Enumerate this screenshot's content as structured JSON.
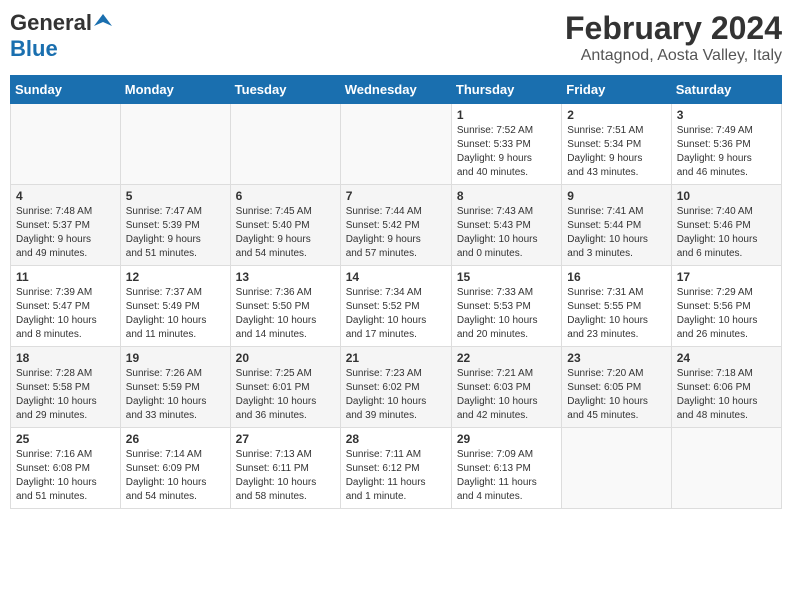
{
  "logo": {
    "general": "General",
    "blue": "Blue"
  },
  "title": "February 2024",
  "subtitle": "Antagnod, Aosta Valley, Italy",
  "columns": [
    "Sunday",
    "Monday",
    "Tuesday",
    "Wednesday",
    "Thursday",
    "Friday",
    "Saturday"
  ],
  "rows": [
    [
      {
        "day": "",
        "detail": ""
      },
      {
        "day": "",
        "detail": ""
      },
      {
        "day": "",
        "detail": ""
      },
      {
        "day": "",
        "detail": ""
      },
      {
        "day": "1",
        "detail": "Sunrise: 7:52 AM\nSunset: 5:33 PM\nDaylight: 9 hours\nand 40 minutes."
      },
      {
        "day": "2",
        "detail": "Sunrise: 7:51 AM\nSunset: 5:34 PM\nDaylight: 9 hours\nand 43 minutes."
      },
      {
        "day": "3",
        "detail": "Sunrise: 7:49 AM\nSunset: 5:36 PM\nDaylight: 9 hours\nand 46 minutes."
      }
    ],
    [
      {
        "day": "4",
        "detail": "Sunrise: 7:48 AM\nSunset: 5:37 PM\nDaylight: 9 hours\nand 49 minutes."
      },
      {
        "day": "5",
        "detail": "Sunrise: 7:47 AM\nSunset: 5:39 PM\nDaylight: 9 hours\nand 51 minutes."
      },
      {
        "day": "6",
        "detail": "Sunrise: 7:45 AM\nSunset: 5:40 PM\nDaylight: 9 hours\nand 54 minutes."
      },
      {
        "day": "7",
        "detail": "Sunrise: 7:44 AM\nSunset: 5:42 PM\nDaylight: 9 hours\nand 57 minutes."
      },
      {
        "day": "8",
        "detail": "Sunrise: 7:43 AM\nSunset: 5:43 PM\nDaylight: 10 hours\nand 0 minutes."
      },
      {
        "day": "9",
        "detail": "Sunrise: 7:41 AM\nSunset: 5:44 PM\nDaylight: 10 hours\nand 3 minutes."
      },
      {
        "day": "10",
        "detail": "Sunrise: 7:40 AM\nSunset: 5:46 PM\nDaylight: 10 hours\nand 6 minutes."
      }
    ],
    [
      {
        "day": "11",
        "detail": "Sunrise: 7:39 AM\nSunset: 5:47 PM\nDaylight: 10 hours\nand 8 minutes."
      },
      {
        "day": "12",
        "detail": "Sunrise: 7:37 AM\nSunset: 5:49 PM\nDaylight: 10 hours\nand 11 minutes."
      },
      {
        "day": "13",
        "detail": "Sunrise: 7:36 AM\nSunset: 5:50 PM\nDaylight: 10 hours\nand 14 minutes."
      },
      {
        "day": "14",
        "detail": "Sunrise: 7:34 AM\nSunset: 5:52 PM\nDaylight: 10 hours\nand 17 minutes."
      },
      {
        "day": "15",
        "detail": "Sunrise: 7:33 AM\nSunset: 5:53 PM\nDaylight: 10 hours\nand 20 minutes."
      },
      {
        "day": "16",
        "detail": "Sunrise: 7:31 AM\nSunset: 5:55 PM\nDaylight: 10 hours\nand 23 minutes."
      },
      {
        "day": "17",
        "detail": "Sunrise: 7:29 AM\nSunset: 5:56 PM\nDaylight: 10 hours\nand 26 minutes."
      }
    ],
    [
      {
        "day": "18",
        "detail": "Sunrise: 7:28 AM\nSunset: 5:58 PM\nDaylight: 10 hours\nand 29 minutes."
      },
      {
        "day": "19",
        "detail": "Sunrise: 7:26 AM\nSunset: 5:59 PM\nDaylight: 10 hours\nand 33 minutes."
      },
      {
        "day": "20",
        "detail": "Sunrise: 7:25 AM\nSunset: 6:01 PM\nDaylight: 10 hours\nand 36 minutes."
      },
      {
        "day": "21",
        "detail": "Sunrise: 7:23 AM\nSunset: 6:02 PM\nDaylight: 10 hours\nand 39 minutes."
      },
      {
        "day": "22",
        "detail": "Sunrise: 7:21 AM\nSunset: 6:03 PM\nDaylight: 10 hours\nand 42 minutes."
      },
      {
        "day": "23",
        "detail": "Sunrise: 7:20 AM\nSunset: 6:05 PM\nDaylight: 10 hours\nand 45 minutes."
      },
      {
        "day": "24",
        "detail": "Sunrise: 7:18 AM\nSunset: 6:06 PM\nDaylight: 10 hours\nand 48 minutes."
      }
    ],
    [
      {
        "day": "25",
        "detail": "Sunrise: 7:16 AM\nSunset: 6:08 PM\nDaylight: 10 hours\nand 51 minutes."
      },
      {
        "day": "26",
        "detail": "Sunrise: 7:14 AM\nSunset: 6:09 PM\nDaylight: 10 hours\nand 54 minutes."
      },
      {
        "day": "27",
        "detail": "Sunrise: 7:13 AM\nSunset: 6:11 PM\nDaylight: 10 hours\nand 58 minutes."
      },
      {
        "day": "28",
        "detail": "Sunrise: 7:11 AM\nSunset: 6:12 PM\nDaylight: 11 hours\nand 1 minute."
      },
      {
        "day": "29",
        "detail": "Sunrise: 7:09 AM\nSunset: 6:13 PM\nDaylight: 11 hours\nand 4 minutes."
      },
      {
        "day": "",
        "detail": ""
      },
      {
        "day": "",
        "detail": ""
      }
    ]
  ]
}
